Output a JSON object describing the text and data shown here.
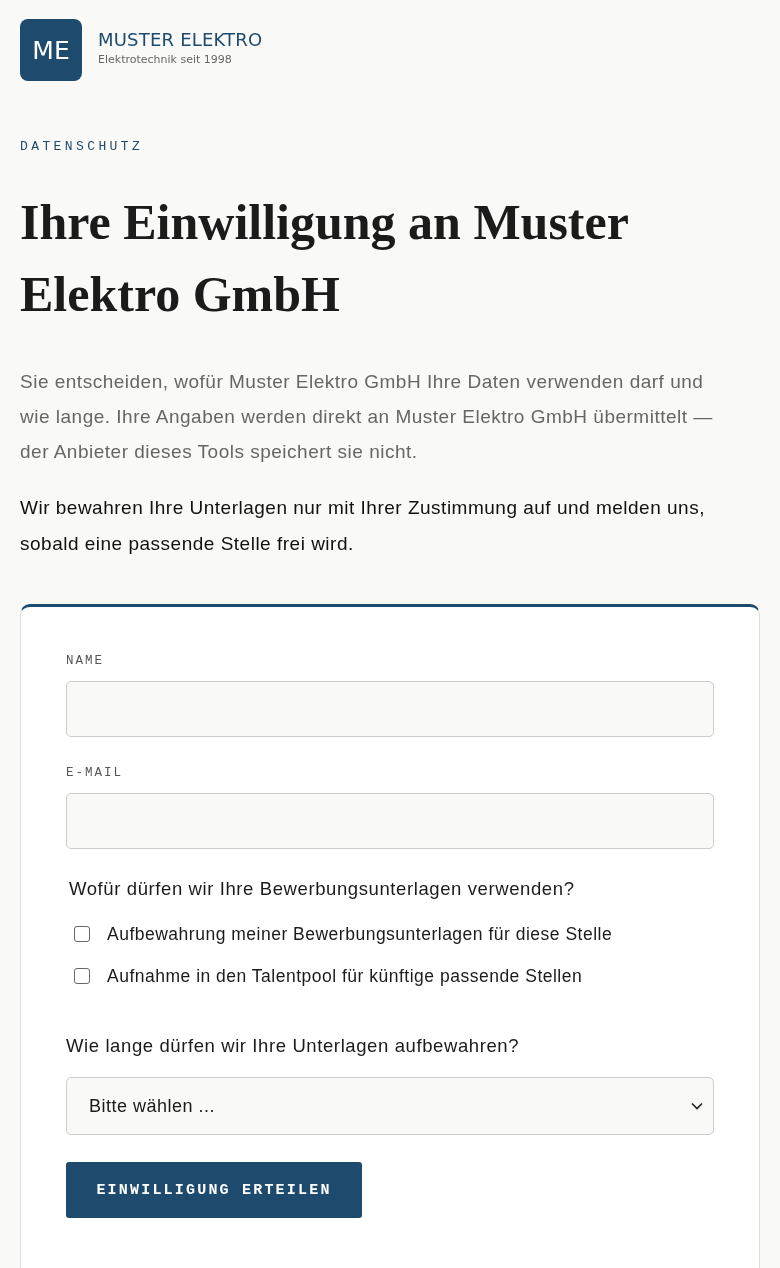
{
  "brand": {
    "logo_text": "ME",
    "name": "MUSTER ELEKTRO",
    "tagline": "Elektrotechnik seit 1998"
  },
  "eyebrow": "DATENSCHUTZ",
  "heading": "Ihre Einwilligung an Muster Elektro GmbH",
  "intro": "Sie entscheiden, wofür Muster Elektro GmbH Ihre Daten verwenden darf und wie lange. Ihre Angaben werden direkt an Muster Elektro GmbH übermittelt — der Anbieter dieses Tools speichert sie nicht.",
  "note": "Wir bewahren Ihre Unterlagen nur mit Ihrer Zustimmung auf und melden uns, sobald eine passende Stelle frei wird.",
  "form": {
    "fields": [
      {
        "label": "NAME"
      },
      {
        "label": "E-MAIL"
      }
    ],
    "purpose": {
      "question": "Wofür dürfen wir Ihre Bewerbungsunterlagen verwenden?",
      "options": [
        {
          "label": "Aufbewahrung meiner Bewerbungsunterlagen für diese Stelle",
          "checked": false
        },
        {
          "label": "Aufnahme in den Talentpool für künftige passende Stellen",
          "checked": false
        }
      ]
    },
    "duration": {
      "question": "Wie lange dürfen wir Ihre Unterlagen aufbewahren?",
      "value": "Bitte wählen ..."
    },
    "submit": "EINWILLIGUNG ERTEILEN"
  }
}
